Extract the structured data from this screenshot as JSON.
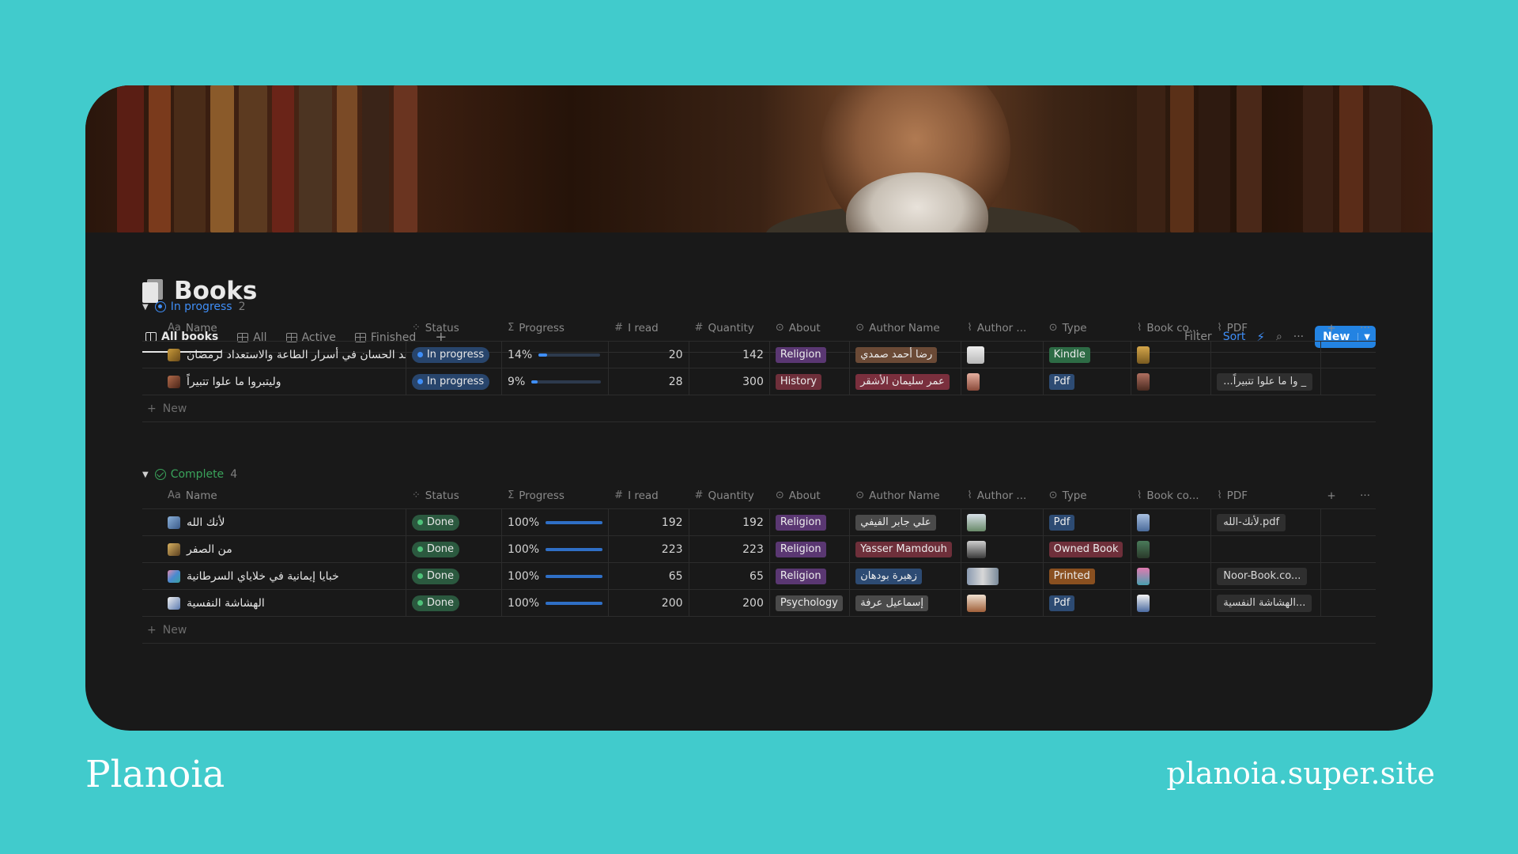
{
  "page": {
    "title": "Books",
    "accent": "#2383e2",
    "background": "#41cbcc"
  },
  "tabs": [
    {
      "label": "All books",
      "active": true
    },
    {
      "label": "All",
      "active": false
    },
    {
      "label": "Active",
      "active": false
    },
    {
      "label": "Finished",
      "active": false
    }
  ],
  "toolbar": {
    "filter": "Filter",
    "sort": "Sort",
    "new": "New"
  },
  "columns": {
    "name": "Name",
    "status": "Status",
    "progress": "Progress",
    "read": "I read",
    "quantity": "Quantity",
    "about": "About",
    "author": "Author Name",
    "author_img": "Author ...",
    "type": "Type",
    "cover": "Book co...",
    "pdf": "PDF",
    "name_prefix": "Aa"
  },
  "groups": {
    "in_progress": {
      "label": "In progress",
      "count": "2",
      "rows": [
        {
          "name": "اعد الحسان في أسرار الطاعة والاستعداد لرمضان",
          "status": "In progress",
          "progress_label": "14%",
          "progress": 0.14,
          "read": "20",
          "quantity": "142",
          "about": "Religion",
          "author": "رضا أحمد صمدي",
          "type": "Kindle",
          "pdf": ""
        },
        {
          "name": "وليتبروا ما علوا تتبيراً",
          "status": "In progress",
          "progress_label": "9%",
          "progress": 0.09,
          "read": "28",
          "quantity": "300",
          "about": "History",
          "author": "عمر سليمان الأشقر",
          "type": "Pdf",
          "pdf": "...وا ما علوا تتبيراً _"
        }
      ]
    },
    "complete": {
      "label": "Complete",
      "count": "4",
      "rows": [
        {
          "name": "لأنك الله",
          "status": "Done",
          "progress_label": "100%",
          "progress": 1,
          "read": "192",
          "quantity": "192",
          "about": "Religion",
          "author": "علي جابر الفيفي",
          "type": "Pdf",
          "pdf": "لأنك-الله.pdf"
        },
        {
          "name": "من الصفر",
          "status": "Done",
          "progress_label": "100%",
          "progress": 1,
          "read": "223",
          "quantity": "223",
          "about": "Religion",
          "author": "Yasser Mamdouh",
          "type": "Owned Book",
          "pdf": ""
        },
        {
          "name": "خبايا إيمانية في خلاياي السرطانية",
          "status": "Done",
          "progress_label": "100%",
          "progress": 1,
          "read": "65",
          "quantity": "65",
          "about": "Religion",
          "author": "زهيرة بودهان",
          "type": "Printed",
          "pdf": "Noor-Book.co..."
        },
        {
          "name": "الهشاشة النفسية",
          "status": "Done",
          "progress_label": "100%",
          "progress": 1,
          "read": "200",
          "quantity": "200",
          "about": "Psychology",
          "author": "إسماعيل عرفة",
          "type": "Pdf",
          "pdf": "الهشاشة النفسية..."
        }
      ]
    }
  },
  "add_row": "New",
  "footer": {
    "brand": "Planoia",
    "site": "planoia.super.site"
  }
}
